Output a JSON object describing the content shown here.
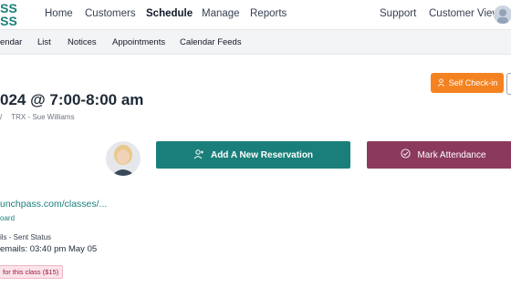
{
  "topnav": {
    "logo_text": "ASS\nSS",
    "items": [
      {
        "label": "Home"
      },
      {
        "label": "Customers"
      },
      {
        "label": "Schedule"
      },
      {
        "label": "Manage"
      },
      {
        "label": "Reports"
      }
    ],
    "support": "Support",
    "customer_view": "Customer View"
  },
  "subnav": {
    "items": [
      "endar",
      "List",
      "Notices",
      "Appointments",
      "Calendar Feeds"
    ]
  },
  "main": {
    "checkin_label": "Self Check-in",
    "title": "024 @ 7:00-8:00 am",
    "breadcrumb": "TRX - Sue Williams",
    "add_reservation": "Add A New Reservation",
    "mark_attendance": "Mark Attendance",
    "link_url": "unchpass.com/classes/...",
    "link_board": "oard",
    "status_heading": "ils - Sent Status",
    "status_value": "emails: 03:40 pm May 05",
    "badge": "for this class ($15)"
  },
  "colors": {
    "accent_teal": "#1a7f7a",
    "attendance_plum": "#8b3a5e",
    "checkin_orange": "#f58220"
  }
}
